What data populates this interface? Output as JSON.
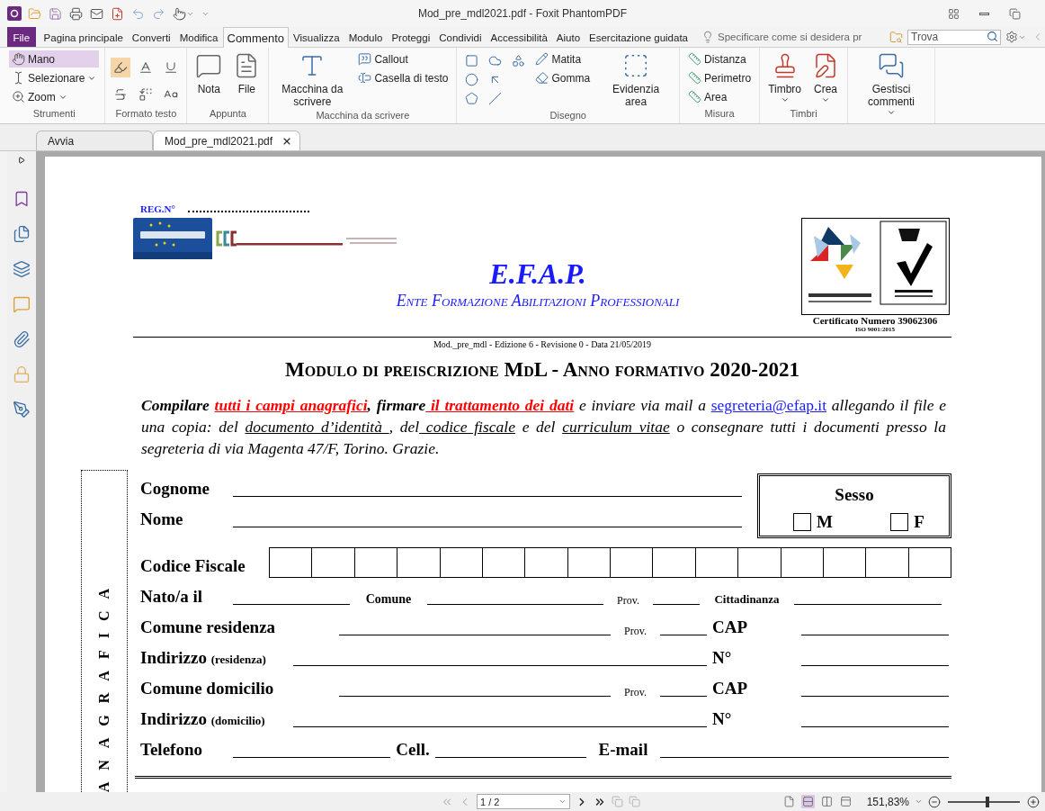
{
  "window": {
    "title": "Mod_pre_mdl2021.pdf - Foxit PhantomPDF"
  },
  "menu_tabs": [
    {
      "label": "File",
      "kind": "file",
      "selected": false
    },
    {
      "label": "Pagina principale",
      "kind": "tab",
      "selected": false
    },
    {
      "label": "Converti",
      "kind": "tab",
      "selected": false
    },
    {
      "label": "Modifica",
      "kind": "tab",
      "selected": false
    },
    {
      "label": "Commento",
      "kind": "tab",
      "selected": true
    },
    {
      "label": "Visualizza",
      "kind": "tab",
      "selected": false
    },
    {
      "label": "Modulo",
      "kind": "tab",
      "selected": false
    },
    {
      "label": "Proteggi",
      "kind": "tab",
      "selected": false
    },
    {
      "label": "Condividi",
      "kind": "tab",
      "selected": false
    },
    {
      "label": "Accessibilità",
      "kind": "tab",
      "selected": false
    },
    {
      "label": "Aiuto",
      "kind": "tab",
      "selected": false
    },
    {
      "label": "Esercitazione guidata",
      "kind": "tab",
      "selected": false
    }
  ],
  "tell_me": {
    "placeholder": "Specificare come si desidera pr"
  },
  "search": {
    "placeholder": "Trova"
  },
  "ribbon": {
    "groups": [
      {
        "label": "Strumenti",
        "items": [
          {
            "kind": "small",
            "label": "Mano",
            "selected": true,
            "dropdown": false
          },
          {
            "kind": "small",
            "label": "Selezionare",
            "selected": false,
            "dropdown": true
          },
          {
            "kind": "small",
            "label": "Zoom",
            "selected": false,
            "dropdown": true
          }
        ]
      },
      {
        "label": "Formato testo",
        "items": [
          {
            "kind": "format",
            "selected": true
          },
          {
            "kind": "format",
            "selected": false
          },
          {
            "kind": "format",
            "selected": false
          },
          {
            "kind": "format",
            "selected": false
          },
          {
            "kind": "format",
            "selected": false
          },
          {
            "kind": "format",
            "selected": false
          }
        ]
      },
      {
        "label": "Appunta",
        "items": [
          {
            "kind": "large",
            "label": "Nota",
            "dropdown": false
          },
          {
            "kind": "large",
            "label": "File",
            "dropdown": false
          }
        ]
      },
      {
        "label": "Macchina da scrivere",
        "items": [
          {
            "kind": "large",
            "label": "Macchina da scrivere",
            "dropdown": false
          },
          {
            "kind": "small",
            "label": "Callout",
            "dropdown": false
          },
          {
            "kind": "small",
            "label": "Casella di testo",
            "dropdown": false
          }
        ]
      },
      {
        "label": "Disegno",
        "items": [
          {
            "kind": "icon"
          },
          {
            "kind": "icon"
          },
          {
            "kind": "icon"
          },
          {
            "kind": "icon"
          },
          {
            "kind": "icon"
          },
          {
            "kind": "icon"
          },
          {
            "kind": "icon"
          },
          {
            "kind": "small",
            "label": "Matita",
            "dropdown": false
          },
          {
            "kind": "small",
            "label": "Gomma",
            "dropdown": false
          },
          {
            "kind": "large",
            "label": "Evidenzia area",
            "dropdown": false
          }
        ]
      },
      {
        "label": "Misura",
        "items": [
          {
            "kind": "small",
            "label": "Distanza",
            "dropdown": false
          },
          {
            "kind": "small",
            "label": "Perimetro",
            "dropdown": false
          },
          {
            "kind": "small",
            "label": "Area",
            "dropdown": false
          }
        ]
      },
      {
        "label": "Timbri",
        "items": [
          {
            "kind": "large",
            "label": "Timbro",
            "dropdown": true
          },
          {
            "kind": "large",
            "label": "Crea",
            "dropdown": true
          }
        ]
      },
      {
        "items": [
          {
            "kind": "large",
            "label": "Gestisci commenti",
            "dropdown": true
          }
        ]
      }
    ]
  },
  "doc_tabs": [
    {
      "label": "Avvia",
      "selected": false,
      "closable": false
    },
    {
      "label": "Mod_pre_mdl2021.pdf",
      "selected": true,
      "closable": true
    }
  ],
  "document": {
    "reg_label": "REG.N°",
    "org_name": "E.F.A.P.",
    "org_full_name": "Ente Formazione Abilitazioni Professionali",
    "certificate": "Certificato Numero 39062306",
    "certificate_standard": "ISO 9001:2015",
    "meta": "Mod._pre_mdl - Edizione 6 - Revisione 0 - Data 21/05/2019",
    "heading": "Modulo di preiscrizione MdL - Anno formativo 2020-2021",
    "instructions": [
      {
        "kind": "strong",
        "text": "Compilare "
      },
      {
        "kind": "alert",
        "text": "tutti i campi anagrafici"
      },
      {
        "kind": "strong",
        "text": ", firmare"
      },
      {
        "kind": "alert",
        "text": " il trattamento dei dati"
      },
      {
        "kind": "plain",
        "text": " e inviare via mail a "
      },
      {
        "kind": "link",
        "text": "segreteria@efap.it"
      },
      {
        "kind": "plain",
        "text": " allegando il file e una copia: del "
      },
      {
        "kind": "underline",
        "text": "documento d’identità "
      },
      {
        "kind": "plain",
        "text": ", del"
      },
      {
        "kind": "underline",
        "text": " codice fiscale"
      },
      {
        "kind": "plain",
        "text": " e del "
      },
      {
        "kind": "underline",
        "text": "curriculum vitae"
      },
      {
        "kind": "plain",
        "text": " o consegnare tutti i documenti presso la segreteria di via Magenta 47/F, Torino. Grazie."
      }
    ],
    "form": {
      "side_label": "ANAGRAFICA",
      "surname_label": "Cognome",
      "name_label": "Nome",
      "sex": {
        "title": "Sesso",
        "options": [
          {
            "label": "M",
            "checked": false
          },
          {
            "label": "F",
            "checked": false
          }
        ]
      },
      "fiscal_code_label": "Codice Fiscale",
      "rows": [
        {
          "kind": "birth",
          "label": "Nato/a il",
          "city": "Comune",
          "prov": "Prov.",
          "extra": "Cittadinanza"
        },
        {
          "kind": "city",
          "label": "Comune residenza",
          "prov": "Prov.",
          "extra": "CAP"
        },
        {
          "kind": "street",
          "label": "Indirizzo",
          "note": "(residenza)",
          "extra": "N°"
        },
        {
          "kind": "city",
          "label": "Comune domicilio",
          "prov": "Prov.",
          "extra": "CAP"
        },
        {
          "kind": "street",
          "label": "Indirizzo",
          "note": "(domicilio)",
          "extra": "N°"
        },
        {
          "kind": "phone",
          "label": "Telefono",
          "mobile": "Cell.",
          "extra": "E-mail"
        }
      ]
    }
  },
  "status_bar": {
    "page": "1 / 2",
    "view_modes": [
      {
        "selected": false
      },
      {
        "selected": true
      },
      {
        "selected": false
      },
      {
        "selected": false
      }
    ],
    "zoom": "151,83%",
    "zoom_slider": {
      "level": 0.55
    }
  }
}
